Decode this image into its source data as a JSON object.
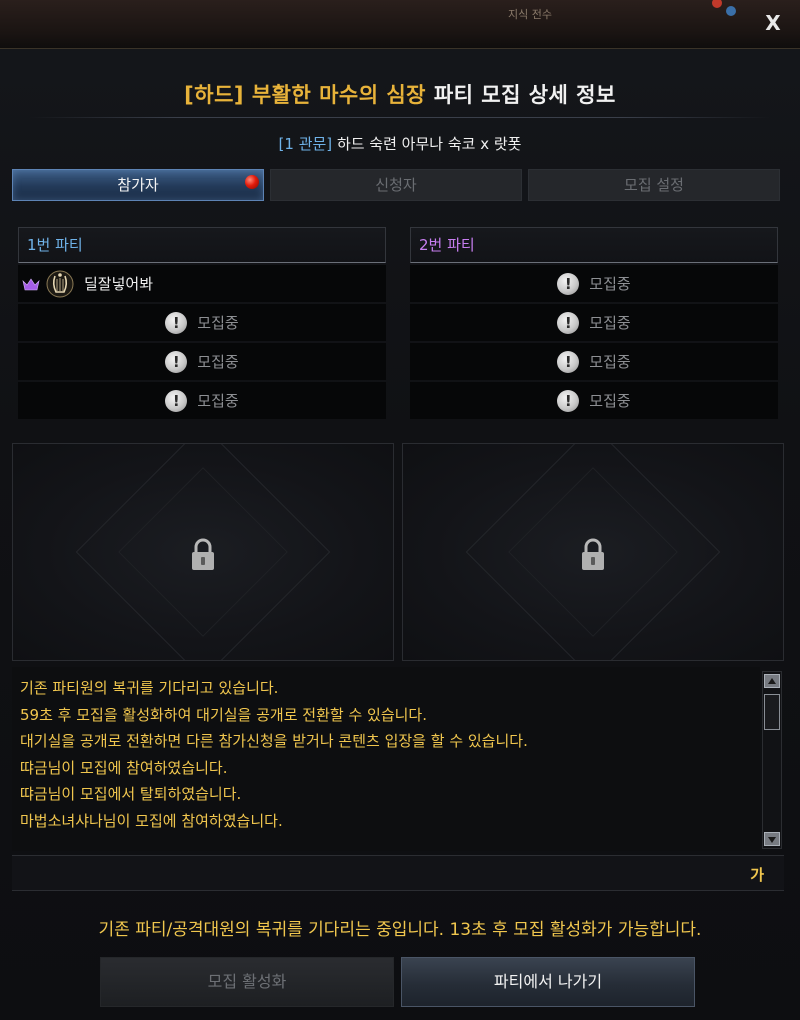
{
  "window": {
    "close_label": "X",
    "background_hint": "지식 전수"
  },
  "title": {
    "highlight": "[하드] 부활한 마수의 심장",
    "rest": "파티 모집 상세 정보"
  },
  "subtitle": {
    "gate": "[1 관문]",
    "text": "하드 숙련 아무나 숙코 x 랏폿"
  },
  "tabs": [
    {
      "label": "참가자",
      "active": true,
      "notification": true
    },
    {
      "label": "신청자",
      "active": false
    },
    {
      "label": "모집 설정",
      "active": false
    }
  ],
  "parties": [
    {
      "title": "1번 파티",
      "color": "#6fb2e8",
      "leader": {
        "name": "딜잘넣어봐",
        "crown_icon": "crown-icon",
        "class_icon": "bard-harp-icon"
      },
      "slots": [
        "모집중",
        "모집중",
        "모집중"
      ]
    },
    {
      "title": "2번 파티",
      "color": "#c77ef0",
      "slots": [
        "모집중",
        "모집중",
        "모집중",
        "모집중"
      ]
    }
  ],
  "log": [
    "기존 파티원의 복귀를 기다리고 있습니다.",
    "59초 후 모집을 활성화하여 대기실을 공개로 전환할 수 있습니다.",
    "대기실을 공개로 전환하면 다른 참가신청을 받거나 콘텐츠 입장을 할 수 있습니다.",
    "땨금님이 모집에 참여하였습니다.",
    "땨금님이 모집에서 탈퇴하였습니다.",
    "마법소녀샤나님이 모집에 참여하였습니다."
  ],
  "chat": {
    "lang_label": "가"
  },
  "status_message": "기존 파티/공격대원의 복귀를 기다리는 중입니다. 13초 후 모집 활성화가 가능합니다.",
  "buttons": {
    "activate": "모집 활성화",
    "leave": "파티에서 나가기"
  },
  "colors": {
    "gold": "#e8b33a",
    "log_text": "#f0c64e",
    "party1": "#6fb2e8",
    "party2": "#c77ef0"
  }
}
